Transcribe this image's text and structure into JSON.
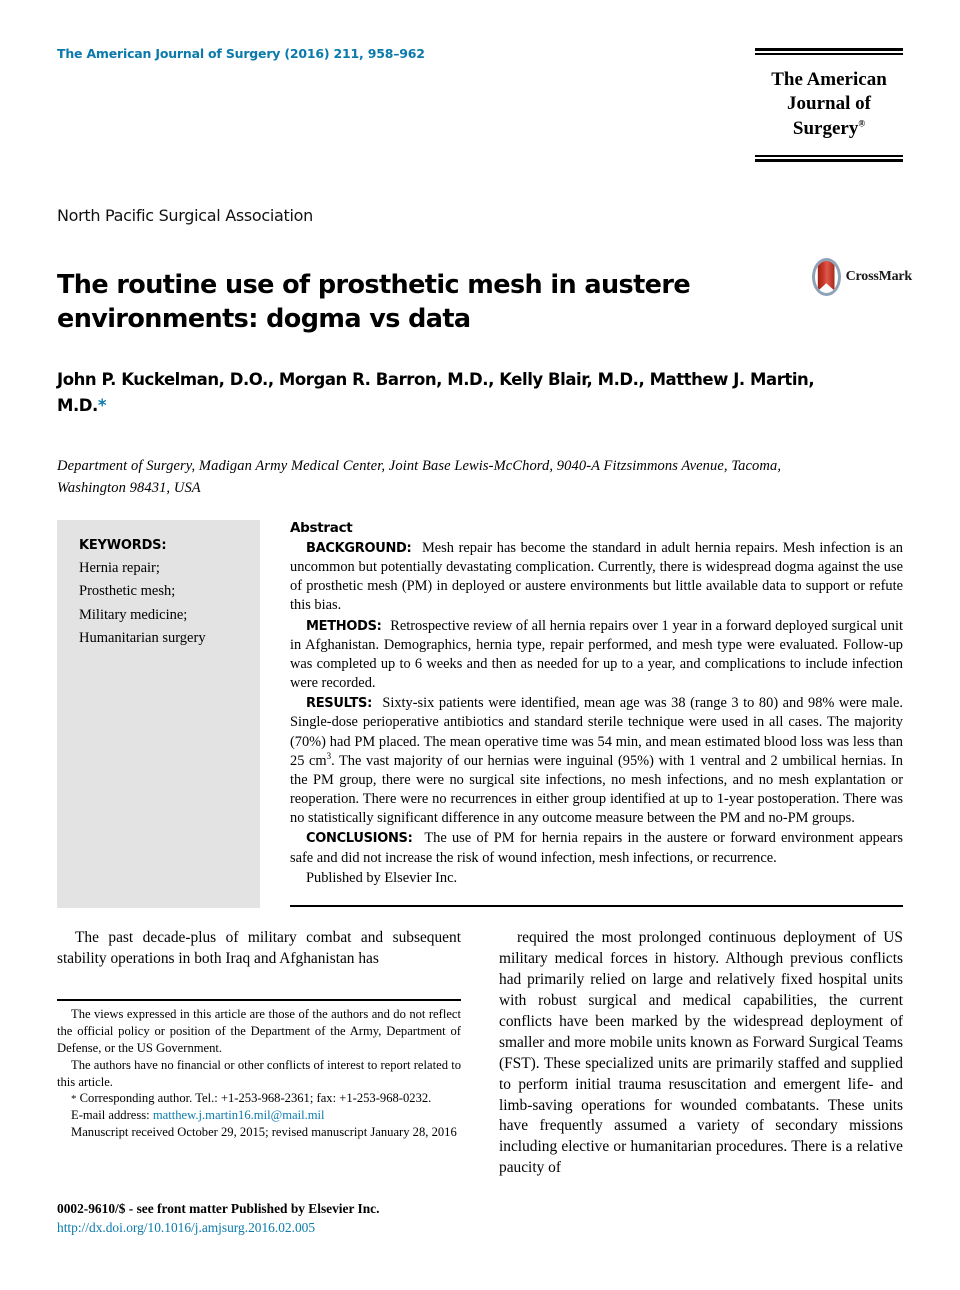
{
  "header": {
    "journal_reference": "The American Journal of Surgery (2016) 211, 958–962",
    "logo_title_line1": "The American",
    "logo_title_line2": "Journal of Surgery",
    "logo_registered_mark": "®"
  },
  "society": "North Pacific Surgical Association",
  "article": {
    "title": "The routine use of prosthetic mesh in austere environments: dogma vs data",
    "authors": "John P. Kuckelman, D.O., Morgan R. Barron, M.D., Kelly Blair, M.D., Matthew J. Martin, M.D.",
    "corresponding_marker": "*",
    "affiliation": "Department of Surgery, Madigan Army Medical Center, Joint Base Lewis-McChord, 9040-A Fitzsimmons Avenue, Tacoma, Washington 98431, USA"
  },
  "crossmark": {
    "label": "CrossMark"
  },
  "keywords": {
    "heading": "KEYWORDS:",
    "items": "Hernia repair;\nProsthetic mesh;\nMilitary medicine;\nHumanitarian surgery"
  },
  "abstract": {
    "heading": "Abstract",
    "background_label": "BACKGROUND:",
    "background_text": "Mesh repair has become the standard in adult hernia repairs. Mesh infection is an uncommon but potentially devastating complication. Currently, there is widespread dogma against the use of prosthetic mesh (PM) in deployed or austere environments but little available data to support or refute this bias.",
    "methods_label": "METHODS:",
    "methods_text": "Retrospective review of all hernia repairs over 1 year in a forward deployed surgical unit in Afghanistan. Demographics, hernia type, repair performed, and mesh type were evaluated. Follow-up was completed up to 6 weeks and then as needed for up to a year, and complications to include infection were recorded.",
    "results_label": "RESULTS:",
    "results_text_part1": "Sixty-six patients were identified, mean age was 38 (range 3 to 80) and 98% were male. Single-dose perioperative antibiotics and standard sterile technique were used in all cases. The majority (70%) had PM placed. The mean operative time was 54 min, and mean estimated blood loss was less than 25 cm",
    "results_superscript": "3",
    "results_text_part2": ". The vast majority of our hernias were inguinal (95%) with 1 ventral and 2 umbilical hernias. In the PM group, there were no surgical site infections, no mesh infections, and no mesh explantation or reoperation. There were no recurrences in either group identified at up to 1-year postoperation. There was no statistically significant difference in any outcome measure between the PM and no-PM groups.",
    "conclusions_label": "CONCLUSIONS:",
    "conclusions_text": "The use of PM for hernia repairs in the austere or forward environment appears safe and did not increase the risk of wound infection, mesh infections, or recurrence.",
    "published_line": "Published by Elsevier Inc."
  },
  "body": {
    "left_column": "The past decade-plus of military combat and subsequent stability operations in both Iraq and Afghanistan has",
    "right_column": "required the most prolonged continuous deployment of US military medical forces in history. Although previous conflicts had primarily relied on large and relatively fixed hospital units with robust surgical and medical capabilities, the current conflicts have been marked by the widespread deployment of smaller and more mobile units known as Forward Surgical Teams (FST). These specialized units are primarily staffed and supplied to perform initial trauma resuscitation and emergent life- and limb-saving operations for wounded combatants. These units have frequently assumed a variety of secondary missions including elective or humanitarian procedures. There is a relative paucity of"
  },
  "footnotes": {
    "disclaimer": "The views expressed in this article are those of the authors and do not reflect the official policy or position of the Department of the Army, Department of Defense, or the US Government.",
    "conflicts": "The authors have no financial or other conflicts of interest to report related to this article.",
    "corresponding_marker": "*",
    "corresponding": "Corresponding author. Tel.: +1-253-968-2361; fax: +1-253-968-0232.",
    "email_label": "E-mail address:",
    "email": "matthew.j.martin16.mil@mail.mil",
    "manuscript_dates": "Manuscript received October 29, 2015; revised manuscript January 28, 2016"
  },
  "page_footer": {
    "front_matter": "0002-9610/$ - see front matter Published by Elsevier Inc.",
    "doi": "http://dx.doi.org/10.1016/j.amjsurg.2016.02.005"
  },
  "colors": {
    "accent_blue": "#0b7aab",
    "keyword_box_grey": "#e3e3e3",
    "crossmark_red": "#c8392b",
    "crossmark_ring": "#8fa3b8"
  }
}
